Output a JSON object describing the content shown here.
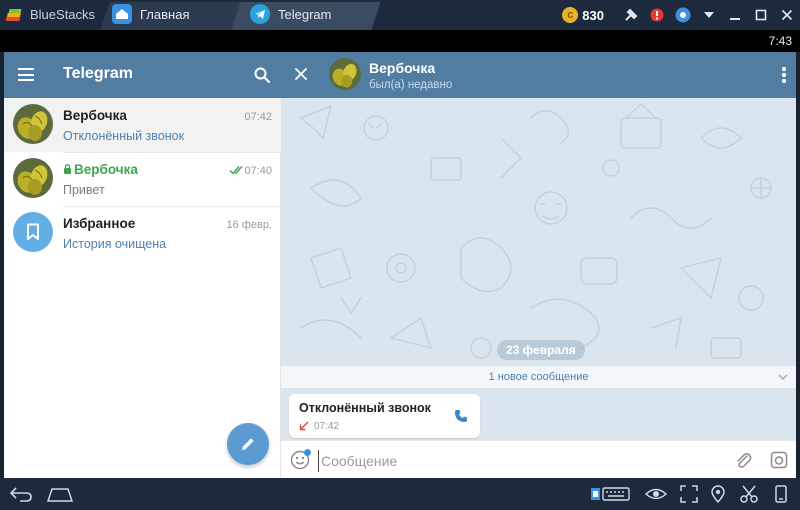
{
  "window": {
    "app_name": "BlueStacks",
    "tabs": [
      {
        "label": "Главная"
      },
      {
        "label": "Telegram"
      }
    ],
    "coins": "830"
  },
  "status_bar": {
    "time": "7:43"
  },
  "sidebar": {
    "title": "Telegram",
    "chats": [
      {
        "name": "Вербочка",
        "message": "Отклонённый звонок",
        "time": "07:42"
      },
      {
        "name": "Вербочка",
        "message": "Привет",
        "time": "07:40",
        "secret": true,
        "read": true
      },
      {
        "name": "Избранное",
        "message": "История очищена",
        "time": "16 февр."
      }
    ]
  },
  "chat": {
    "peer_name": "Вербочка",
    "peer_status": "был(а) недавно",
    "date_label": "23 февраля",
    "unread_label": "1 новое сообщение",
    "message": {
      "title": "Отклонённый звонок",
      "time": "07:42"
    },
    "composer_placeholder": "Сообщение"
  },
  "colors": {
    "header": "#527da3",
    "accent_text": "#4e7fad",
    "secret_green": "#3ea64c",
    "fab": "#5c9bd1",
    "missed_red": "#e0483e"
  },
  "icons": [
    "menu-icon",
    "search-icon",
    "close-icon",
    "more-icon",
    "pencil-icon",
    "phone-icon",
    "emoji-icon",
    "attach-icon",
    "camera-icon",
    "lock-icon",
    "double-check-icon",
    "bookmark-icon"
  ]
}
